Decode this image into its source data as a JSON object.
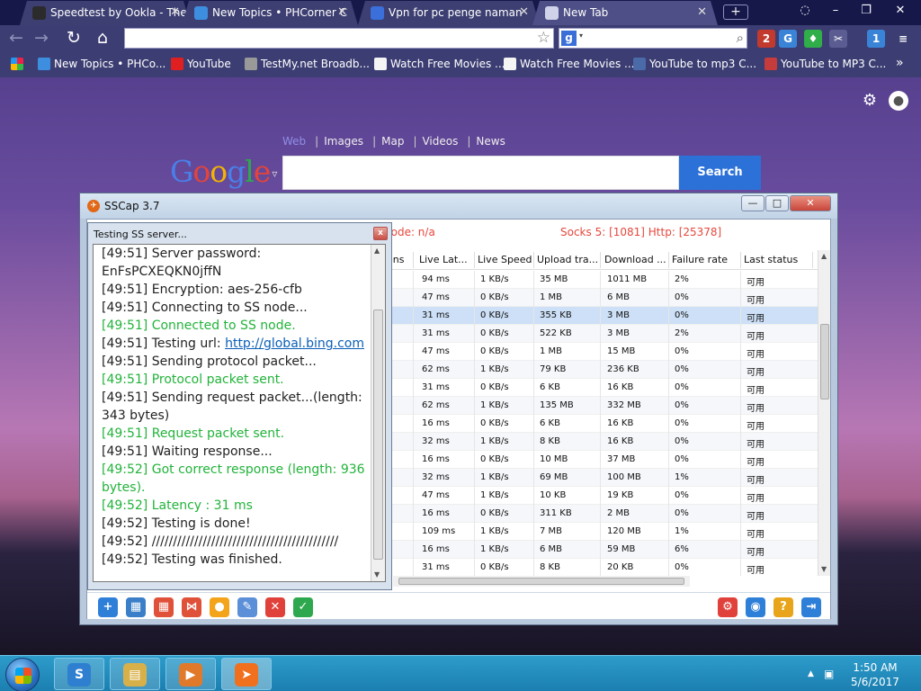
{
  "browser": {
    "tabs": [
      {
        "label": "Speedtest by Ookla - The",
        "close": "✕",
        "icon_color": "#2b2b2b"
      },
      {
        "label": "New Topics • PHCorner C",
        "close": "✕",
        "icon_color": "#3e8ee0"
      },
      {
        "label": "Vpn for pc penge naman",
        "close": "✕",
        "icon_color": "#3b6fd9"
      },
      {
        "label": "New Tab",
        "close": "✕",
        "icon_color": "#cfd2e8"
      }
    ],
    "new_tab_symbol": "+",
    "window_buttons": {
      "minimize": "–",
      "restore": "❐",
      "close": "✕"
    },
    "nav": {
      "back": "←",
      "forward": "→",
      "reload": "↻",
      "home": "⌂"
    },
    "omnibox_value": "",
    "search_engine_letter": "g",
    "search_box_value": "",
    "extensions": [
      {
        "name": "sscap-ext",
        "label": "2",
        "color": "#c23a2e"
      },
      {
        "name": "translate-ext",
        "label": "G",
        "color": "#3a84d8"
      },
      {
        "name": "shield-ext",
        "label": "♦",
        "color": "#2fae4a"
      },
      {
        "name": "scissors-ext",
        "label": "✂",
        "color": "#5b5d92"
      },
      {
        "name": "download-ext",
        "label": "1",
        "color": "#3a84d8"
      },
      {
        "name": "menu-ext",
        "label": "≡",
        "color": "#3c3e73"
      }
    ],
    "bookmarks": [
      {
        "label": "New Topics • PHCo...",
        "icon_color": "#3e8ee0"
      },
      {
        "label": "YouTube",
        "icon_color": "#e02020"
      },
      {
        "label": "TestMy.net Broadb...",
        "icon_color": "#999999"
      },
      {
        "label": "Watch Free Movies ...",
        "icon_color": "#f4f4f4"
      },
      {
        "label": "Watch Free Movies ...",
        "icon_color": "#f4f4f4"
      },
      {
        "label": "YouTube to mp3 C...",
        "icon_color": "#4a6aa8"
      },
      {
        "label": "YouTube to MP3 C...",
        "icon_color": "#c63b3b"
      }
    ],
    "bookmarks_overflow": "»"
  },
  "ntp": {
    "settings_icon": "⚙",
    "account_icon": "●",
    "links": [
      "Web",
      "Images",
      "Map",
      "Videos",
      "News"
    ],
    "logo_letters": [
      {
        "ch": "G",
        "color": "#4a7fe8"
      },
      {
        "ch": "o",
        "color": "#e4443a"
      },
      {
        "ch": "o",
        "color": "#f4b400"
      },
      {
        "ch": "g",
        "color": "#4a7fe8"
      },
      {
        "ch": "l",
        "color": "#2ea84e"
      },
      {
        "ch": "e",
        "color": "#e4443a"
      }
    ],
    "logo_caret": "▿",
    "search_value": "",
    "search_button": "Search"
  },
  "sscap": {
    "title": "SSCap 3.7",
    "window_buttons": {
      "minimize": "—",
      "maximize": "□",
      "close": "✕"
    },
    "current_node": "node: n/a",
    "socks_info": "Socks 5: [1081] Http: [25378]",
    "columns": [
      "ons",
      "Live Lat...",
      "Live Speed",
      "Upload tra...",
      "Download ...",
      "Failure rate",
      "Last status"
    ],
    "rows": [
      [
        "94 ms",
        "1 KB/s",
        "35 MB",
        "1011 MB",
        "2%",
        "可用"
      ],
      [
        "47 ms",
        "0 KB/s",
        "1 MB",
        "6 MB",
        "0%",
        "可用"
      ],
      [
        "31 ms",
        "0 KB/s",
        "355 KB",
        "3 MB",
        "0%",
        "可用"
      ],
      [
        "31 ms",
        "0 KB/s",
        "522 KB",
        "3 MB",
        "2%",
        "可用"
      ],
      [
        "47 ms",
        "0 KB/s",
        "1 MB",
        "15 MB",
        "0%",
        "可用"
      ],
      [
        "62 ms",
        "1 KB/s",
        "79 KB",
        "236 KB",
        "0%",
        "可用"
      ],
      [
        "31 ms",
        "0 KB/s",
        "6 KB",
        "16 KB",
        "0%",
        "可用"
      ],
      [
        "62 ms",
        "1 KB/s",
        "135 MB",
        "332 MB",
        "0%",
        "可用"
      ],
      [
        "16 ms",
        "0 KB/s",
        "6 KB",
        "16 KB",
        "0%",
        "可用"
      ],
      [
        "32 ms",
        "1 KB/s",
        "8 KB",
        "16 KB",
        "0%",
        "可用"
      ],
      [
        "16 ms",
        "0 KB/s",
        "10 MB",
        "37 MB",
        "0%",
        "可用"
      ],
      [
        "32 ms",
        "1 KB/s",
        "69 MB",
        "100 MB",
        "1%",
        "可用"
      ],
      [
        "47 ms",
        "1 KB/s",
        "10 KB",
        "19 KB",
        "0%",
        "可用"
      ],
      [
        "16 ms",
        "0 KB/s",
        "311 KB",
        "2 MB",
        "0%",
        "可用"
      ],
      [
        "109 ms",
        "1 KB/s",
        "7 MB",
        "120 MB",
        "1%",
        "可用"
      ],
      [
        "16 ms",
        "1 KB/s",
        "6 MB",
        "59 MB",
        "6%",
        "可用"
      ],
      [
        "31 ms",
        "0 KB/s",
        "8 KB",
        "20 KB",
        "0%",
        "可用"
      ]
    ],
    "toolbar_left": [
      {
        "name": "add-server-button",
        "label": "+",
        "color": "#2e7fd8"
      },
      {
        "name": "server-list-button",
        "label": "▦",
        "color": "#3a7fc8"
      },
      {
        "name": "grid-view-button",
        "label": "▦",
        "color": "#e0513a"
      },
      {
        "name": "share-button",
        "label": "⋈",
        "color": "#e0513a"
      },
      {
        "name": "bulb-button",
        "label": "●",
        "color": "#f3a41a"
      },
      {
        "name": "edit-button",
        "label": "✎",
        "color": "#5b8fd8"
      },
      {
        "name": "delete-button",
        "label": "✕",
        "color": "#e0413a"
      },
      {
        "name": "test-button",
        "label": "✓",
        "color": "#2ea84e"
      }
    ],
    "toolbar_right": [
      {
        "name": "settings-button",
        "label": "⚙",
        "color": "#e0413a"
      },
      {
        "name": "browser-button",
        "label": "◉",
        "color": "#2e7fd8"
      },
      {
        "name": "help-button",
        "label": "?",
        "color": "#e8a41a"
      },
      {
        "name": "exit-button",
        "label": "⇥",
        "color": "#2e7fd8"
      }
    ]
  },
  "test_dialog": {
    "title": "Testing SS server...",
    "close": "x",
    "log": [
      {
        "text": "[49:51]  Server password:",
        "style": "normal"
      },
      {
        "text": "EnFsPCXEQKN0jffN",
        "style": "normal"
      },
      {
        "text": "[49:51]  Encryption: aes-256-cfb",
        "style": "normal"
      },
      {
        "text": "[49:51]  Connecting to SS node...",
        "style": "normal"
      },
      {
        "text": "[49:51]  Connected to SS node.",
        "style": "green"
      },
      {
        "text": "[49:51]  Testing url: ",
        "style": "link",
        "link": "http://global.bing.com"
      },
      {
        "text": "[49:51]  Sending protocol packet...",
        "style": "normal"
      },
      {
        "text": "[49:51]  Protocol packet sent.",
        "style": "green"
      },
      {
        "text": "[49:51]  Sending request packet...(length:",
        "style": "normal"
      },
      {
        "text": "343 bytes)",
        "style": "normal"
      },
      {
        "text": "[49:51]  Request packet sent.",
        "style": "green"
      },
      {
        "text": "[49:51]  Waiting response...",
        "style": "normal"
      },
      {
        "text": "[49:52]  Got correct response (length: 936",
        "style": "green"
      },
      {
        "text": "bytes).",
        "style": "green"
      },
      {
        "text": "[49:52]  Latency : 31 ms",
        "style": "green"
      },
      {
        "text": "[49:52]  Testing is done!",
        "style": "normal"
      },
      {
        "text": "[49:52]  ////////////////////////////////////////////",
        "style": "normal"
      },
      {
        "text": "[49:52]  Testing was finished.",
        "style": "normal"
      }
    ]
  },
  "taskbar": {
    "apps": [
      {
        "name": "taskbar-app-sscap",
        "label": "S",
        "color": "#2f7fd0"
      },
      {
        "name": "taskbar-app-explorer",
        "label": "▤",
        "color": "#d8b04a"
      },
      {
        "name": "taskbar-app-media",
        "label": "▶",
        "color": "#e07a2a"
      },
      {
        "name": "taskbar-app-paper-plane",
        "label": "➤",
        "color": "#f0701e"
      }
    ],
    "tray_up": "▲",
    "time": "1:50 AM",
    "date": "5/6/2017"
  }
}
